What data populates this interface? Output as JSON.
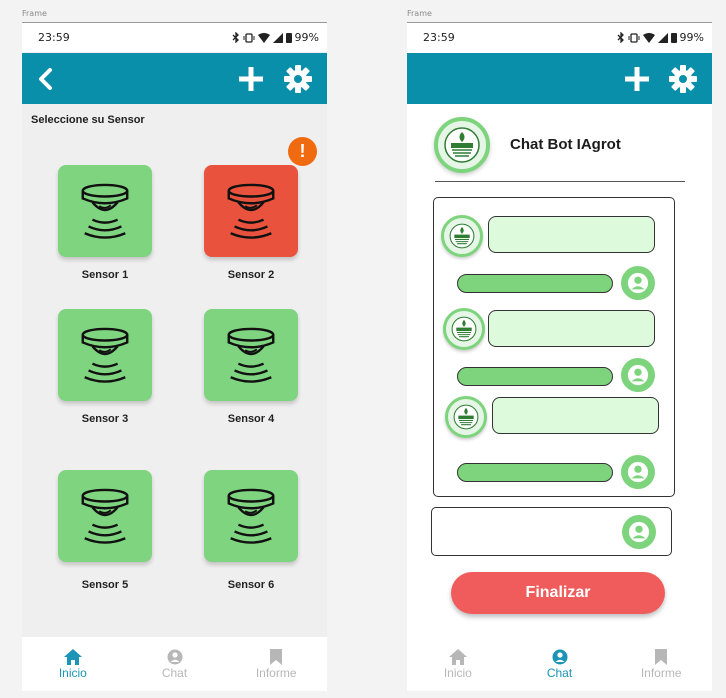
{
  "frames": [
    {
      "label": "Frame"
    },
    {
      "label": "Frame"
    }
  ],
  "status_bar": {
    "time": "23:59",
    "battery": "99%"
  },
  "screen_sensors": {
    "section_title": "Seleccione su Sensor",
    "alert_badge": "!",
    "sensors": [
      {
        "label": "Sensor 1",
        "status": "ok"
      },
      {
        "label": "Sensor 2",
        "status": "alert"
      },
      {
        "label": "Sensor 3",
        "status": "ok"
      },
      {
        "label": "Sensor 4",
        "status": "ok"
      },
      {
        "label": "Sensor 5",
        "status": "ok"
      },
      {
        "label": "Sensor 6",
        "status": "ok"
      }
    ]
  },
  "screen_chat": {
    "bot_title": "Chat Bot IAgrot",
    "finalize_label": "Finalizar"
  },
  "bottom_nav": {
    "items": [
      {
        "label": "Inicio",
        "icon": "home-icon"
      },
      {
        "label": "Chat",
        "icon": "user-icon"
      },
      {
        "label": "Informe",
        "icon": "bookmark-icon"
      }
    ]
  },
  "colors": {
    "appbar": "#0a8fab",
    "sensor_ok": "#7fd47f",
    "sensor_alert": "#e9533d",
    "alert_badge": "#f06a0f",
    "nav_active": "#1b94b5",
    "finalize": "#f05c5c"
  }
}
